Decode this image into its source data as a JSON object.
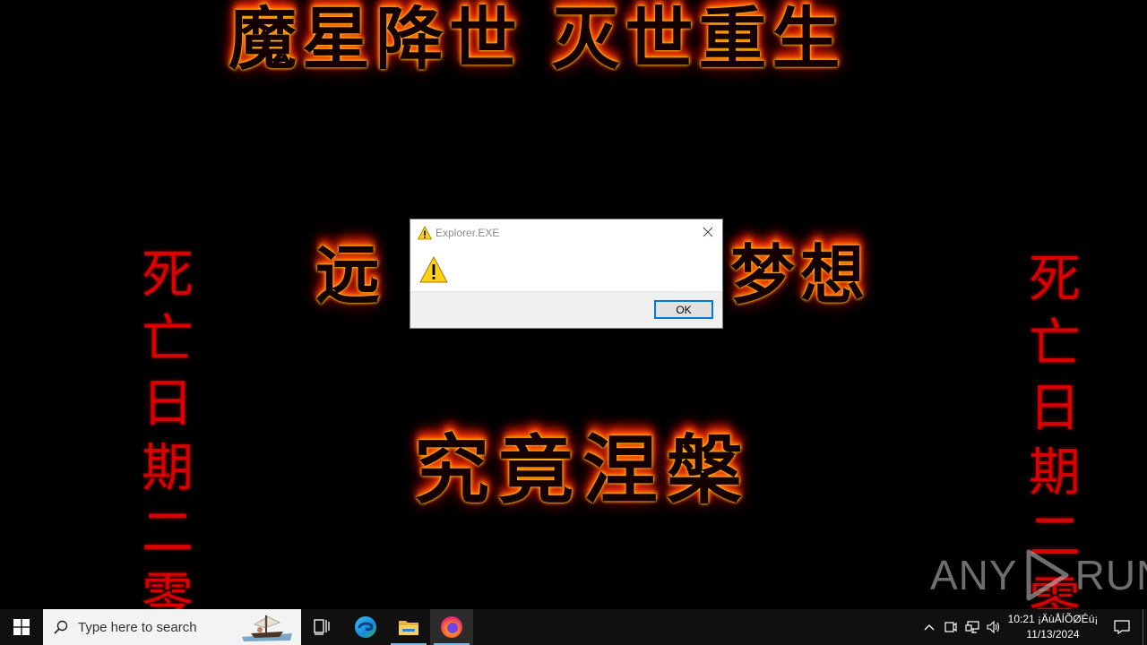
{
  "wallpaper": {
    "title_top": "魔星降世 灭世重生",
    "middle_left": "远",
    "middle_right": "梦想",
    "bottom_center": "究竟涅槃",
    "vertical_left": [
      "死",
      "亡",
      "日",
      "期",
      "二",
      "零"
    ],
    "vertical_right": [
      "死",
      "亡",
      "日",
      "期",
      "二",
      "零"
    ]
  },
  "watermark": {
    "left": "ANY",
    "right": "RUN"
  },
  "dialog": {
    "title": "Explorer.EXE",
    "message": "",
    "ok_label": "OK"
  },
  "taskbar": {
    "search_placeholder": "Type here to search",
    "clock_time": "10:21 ¡ÄùÅÍÕØÉú¡",
    "clock_date": "11/13/2024"
  },
  "colors": {
    "taskbar_bg": "#101010",
    "accent": "#0078d7",
    "fire_red": "#d80000",
    "dialog_footer": "#f0f0f0"
  },
  "icons": {
    "start": "windows-logo-icon",
    "search": "search-icon",
    "task_view": "task-view-icon",
    "edge": "edge-icon",
    "file_explorer": "folder-icon",
    "firefox": "firefox-icon",
    "warning": "warning-icon",
    "close": "close-icon"
  }
}
